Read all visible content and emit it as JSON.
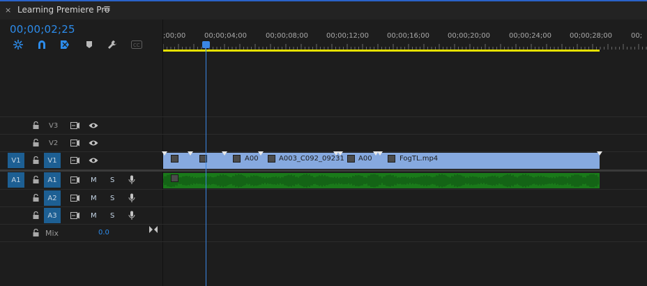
{
  "tab": {
    "close": "×",
    "title": "Learning Premiere Pro",
    "menu": "≡"
  },
  "timecode": "00;00;02;25",
  "toolbar": [
    {
      "name": "snap-icon"
    },
    {
      "name": "linked-selection-icon"
    },
    {
      "name": "add-marker-icon"
    },
    {
      "name": "marker-icon"
    },
    {
      "name": "wrench-icon"
    },
    {
      "name": "captions-icon"
    }
  ],
  "ruler": {
    "labels": [
      ";00;00",
      "00;00;04;00",
      "00;00;08;00",
      "00;00;12;00",
      "00;00;16;00",
      "00;00;20;00",
      "00;00;24;00",
      "00;00;28;00",
      "00;"
    ]
  },
  "tracks": {
    "v3": {
      "label": "V3"
    },
    "v2": {
      "label": "V2"
    },
    "v1": {
      "source": "V1",
      "label": "V1"
    },
    "a1": {
      "source": "A1",
      "label": "A1",
      "mute": "M",
      "solo": "S"
    },
    "a2": {
      "label": "A2",
      "mute": "M",
      "solo": "S"
    },
    "a3": {
      "label": "A3",
      "mute": "M",
      "solo": "S"
    },
    "mix": {
      "label": "Mix",
      "value": "0.0"
    }
  },
  "clips": {
    "c3": "A00",
    "c4": "A003_C092_09231",
    "c5": "A00",
    "c6": "FogTL.mp4"
  },
  "colors": {
    "accent": "#2d8ceb",
    "video_clip": "#86a9df",
    "audio_clip": "#1a7a1a",
    "work_area": "#e5e000",
    "track_target": "#1d5f93"
  }
}
